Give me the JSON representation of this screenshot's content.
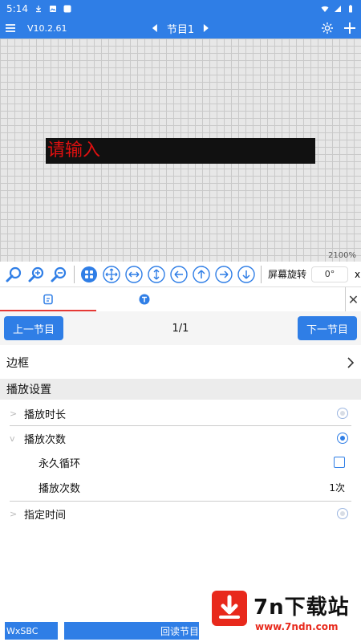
{
  "status_bar": {
    "time": "5:14"
  },
  "app_bar": {
    "version": "V10.2.61",
    "program_title": "节目1"
  },
  "canvas": {
    "led_text": "请输入",
    "zoom_level": "2100%"
  },
  "toolbar": {
    "rotation_label": "屏幕旋转",
    "rotation_value": "0°",
    "close_label": "x"
  },
  "pager": {
    "prev_label": "上一节目",
    "page_indicator": "1/1",
    "next_label": "下一节目"
  },
  "border_row": {
    "label": "边框"
  },
  "play_settings": {
    "title": "播放设置",
    "play_duration": "播放时长",
    "play_count_mode": "播放次数",
    "loop_forever": "永久循环",
    "play_times_label": "播放次数",
    "play_times_value": "1次",
    "specified_time": "指定时间"
  },
  "bottom_bar": {
    "device_chip": "WxSBC",
    "read_button": "回读节目"
  },
  "watermark": {
    "name": "7n下载站",
    "url": "www.7ndn.com"
  },
  "colors": {
    "primary": "#2f7ee6",
    "led_text": "#e01010",
    "accent_red": "#e53935"
  }
}
